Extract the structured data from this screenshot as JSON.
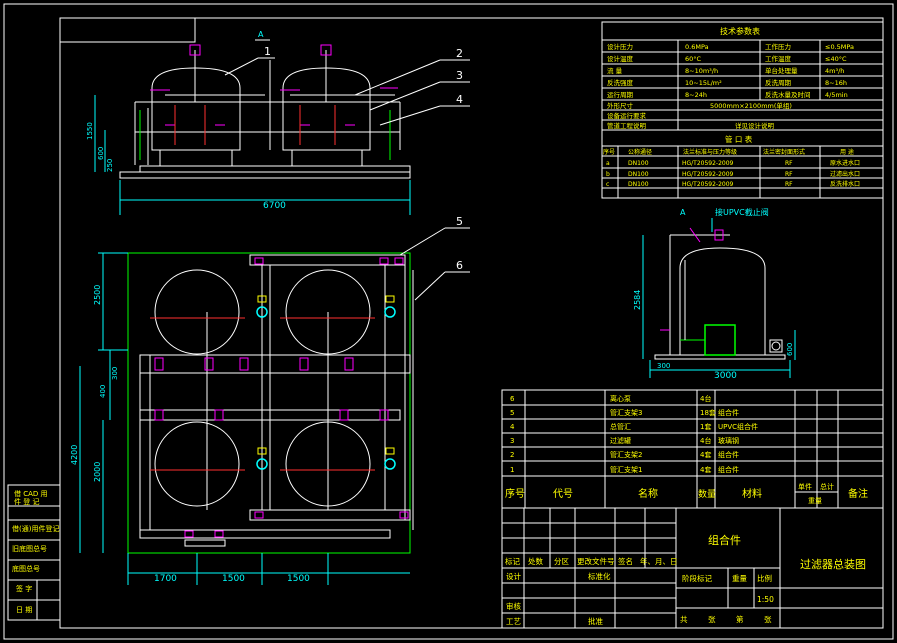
{
  "drawing": {
    "title": "过滤器总装图",
    "part_name": "组合件",
    "scale": "1:50"
  },
  "tech_table": {
    "title": "技术参数表",
    "rows": [
      [
        "设计压力",
        "0.6MPa",
        "工作压力",
        "≤0.5MPa"
      ],
      [
        "设计温度",
        "60°C",
        "工作温度",
        "≤40°C"
      ],
      [
        "流  量",
        "8~10m³/h",
        "单台处理量",
        "4m³/h"
      ],
      [
        "反洗强度",
        "10~15L/m²",
        "反洗周期",
        "8~16h"
      ],
      [
        "运行周期",
        "8~24h",
        "反洗水量及时间",
        "4/5min"
      ],
      [
        "外形尺寸",
        "5000mm×2100mm(单组)",
        "",
        ""
      ],
      [
        "设备运行要求",
        "",
        "",
        ""
      ],
      [
        "管道工程说明",
        "",
        "详见设计说明",
        ""
      ]
    ]
  },
  "nozzle_table": {
    "title": "管 口 表",
    "headers": [
      "序号",
      "公称通径",
      "法兰标准与压力等级",
      "法兰密封面形式",
      "用  途"
    ],
    "rows": [
      [
        "a",
        "DN100",
        "HG/T20592-2009",
        "RF",
        "原水进水口"
      ],
      [
        "b",
        "DN100",
        "HG/T20592-2009",
        "RF",
        "过滤出水口"
      ],
      [
        "c",
        "DN100",
        "HG/T20592-2009",
        "RF",
        "反洗排水口"
      ]
    ]
  },
  "parts_list": {
    "headers": [
      "序号",
      "代号",
      "名称",
      "数量",
      "材料",
      "单件",
      "总计",
      "备注"
    ],
    "weight_header": "重量",
    "rows": [
      [
        "6",
        "",
        "离心泵",
        "4台",
        "",
        ""
      ],
      [
        "5",
        "",
        "管汇支架3",
        "18套",
        "组合件",
        ""
      ],
      [
        "4",
        "",
        "总管汇",
        "1套",
        "UPVC组合件",
        ""
      ],
      [
        "3",
        "",
        "过滤罐",
        "4台",
        "玻璃钢",
        ""
      ],
      [
        "2",
        "",
        "管汇支架2",
        "4套",
        "组合件",
        ""
      ],
      [
        "1",
        "",
        "管汇支架1",
        "4套",
        "组合件",
        ""
      ]
    ]
  },
  "title_block": {
    "labels": [
      "标记",
      "处数",
      "分区",
      "更改文件号",
      "签名",
      "年、月、日"
    ],
    "design": "设计",
    "standardize": "标准化",
    "stage_mark": "阶段标记",
    "weight": "重量",
    "scale_label": "比例",
    "review": "审核",
    "process": "工艺",
    "approve": "批准",
    "sheet_total": "共",
    "sheet_label": "张",
    "sheet_no": "第",
    "sheet_label2": "张"
  },
  "left_strip": {
    "rows": [
      "借(通)用件登记",
      "旧底图总号",
      "底图总号",
      "签  字",
      "日  期"
    ],
    "mini_labels": [
      "借 CAD 用",
      "件 登 记"
    ]
  },
  "callouts": [
    "1",
    "2",
    "3",
    "4",
    "5",
    "6"
  ],
  "section_mark": "A",
  "section_note": "接UPVC截止阀",
  "dimensions": {
    "front_width": "6700",
    "front_h1": "1550",
    "front_h2": "600",
    "front_h3": "250",
    "plan_h1": "2500",
    "plan_h2": "400",
    "plan_h3": "300",
    "plan_h4": "4200",
    "plan_h5": "2000",
    "plan_w1": "1700",
    "plan_w2": "1500",
    "plan_w3": "1500",
    "side_width": "3000",
    "side_h1": "2584",
    "side_h2": "300",
    "side_h3": "600"
  },
  "colors": {
    "background": "#000000",
    "line": "#ffffff",
    "dimension": "#00ffff",
    "pipe_fitting": "#ff00ff",
    "valve": "#ffff00",
    "pump": "#00ff00"
  }
}
